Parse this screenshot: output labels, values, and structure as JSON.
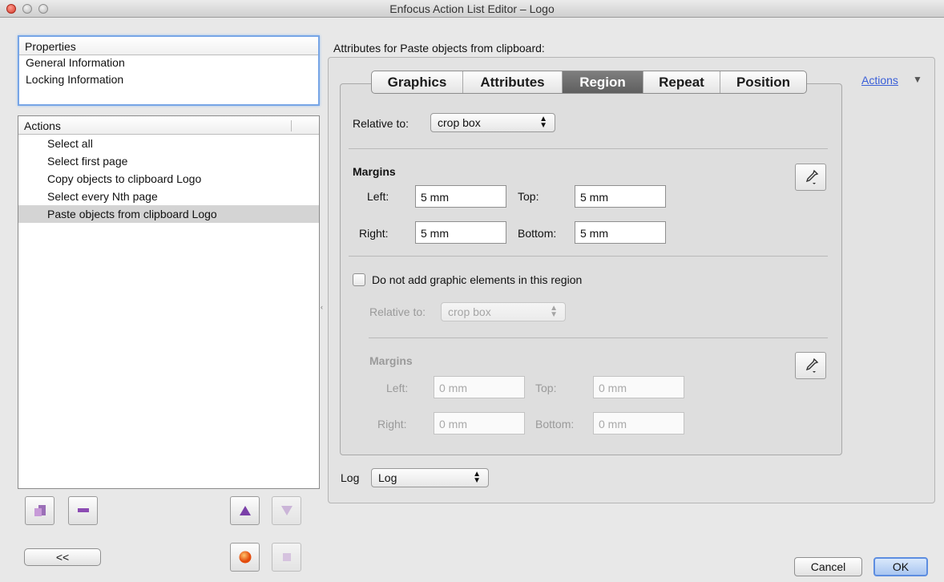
{
  "window": {
    "title": "Enfocus Action List Editor – Logo"
  },
  "properties": {
    "header": "Properties",
    "items": [
      "General Information",
      "Locking Information"
    ]
  },
  "actions_list": {
    "header": "Actions",
    "items": [
      "Select all",
      "Select first page",
      "Copy objects to clipboard Logo",
      "Select every Nth page",
      "Paste objects from clipboard Logo"
    ],
    "selected_index": 4
  },
  "left_buttons": {
    "collapse_label": "<<"
  },
  "right": {
    "heading": "Attributes for Paste objects from clipboard:",
    "actions_link": "Actions",
    "tabs": [
      "Graphics",
      "Attributes",
      "Region",
      "Repeat",
      "Position"
    ],
    "active_tab": "Region",
    "region": {
      "relative_label": "Relative to:",
      "relative_value": "crop box",
      "margins_label": "Margins",
      "left_label": "Left:",
      "left_value": "5 mm",
      "top_label": "Top:",
      "top_value": "5 mm",
      "right_label": "Right:",
      "right_value": "5 mm",
      "bottom_label": "Bottom:",
      "bottom_value": "5 mm"
    },
    "exclusion": {
      "checkbox_label": "Do not add graphic elements in this region",
      "checked": false,
      "relative_label": "Relative to:",
      "relative_value": "crop box",
      "margins_label": "Margins",
      "left_label": "Left:",
      "left_value": "0 mm",
      "top_label": "Top:",
      "top_value": "0 mm",
      "right_label": "Right:",
      "right_value": "0 mm",
      "bottom_label": "Bottom:",
      "bottom_value": "0 mm"
    },
    "log_label": "Log",
    "log_value": "Log"
  },
  "footer": {
    "cancel": "Cancel",
    "ok": "OK"
  }
}
